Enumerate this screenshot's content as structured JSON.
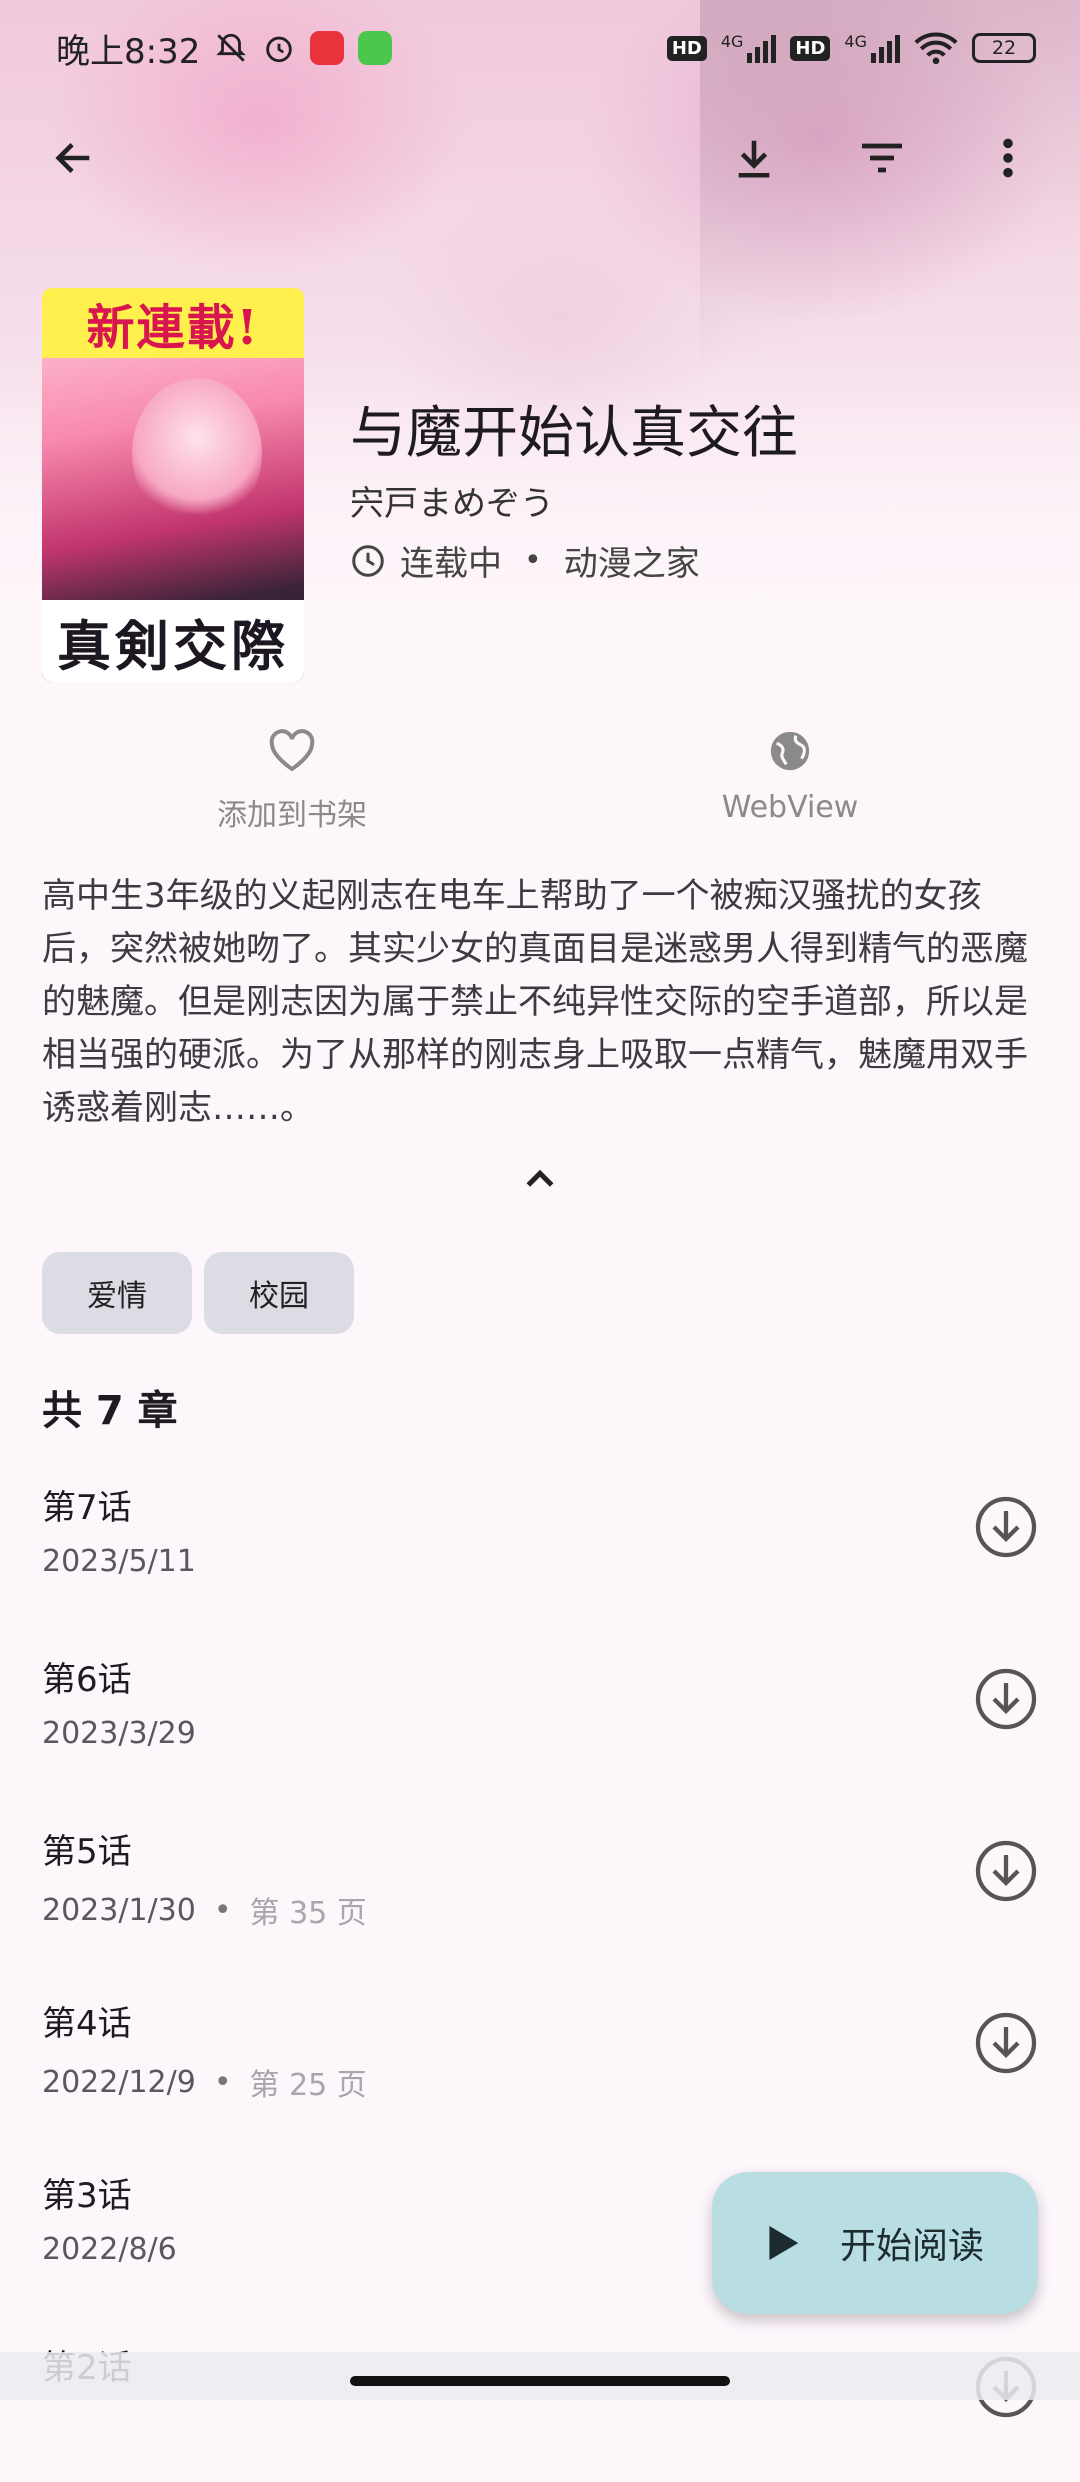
{
  "status_bar": {
    "time": "晚上8:32",
    "network_1": "4G",
    "network_2": "4G",
    "hd_1": "HD",
    "hd_2": "HD",
    "battery": "22"
  },
  "toolbar": {
    "back_icon": "arrow-left-icon",
    "download_icon": "download-icon",
    "filter_icon": "filter-icon",
    "more_icon": "more-vert-icon"
  },
  "manga": {
    "cover_top_text": "新連載!",
    "cover_bottom_text": "真剣交際",
    "title": "与魔开始认真交往",
    "author": "宍戸まめぞう",
    "status": "连载中",
    "source": "动漫之家"
  },
  "actions": {
    "add_to_library": "添加到书架",
    "webview": "WebView"
  },
  "description": "高中生3年级的义起刚志在电车上帮助了一个被痴汉骚扰的女孩后，突然被她吻了。其实少女的真面目是迷惑男人得到精气的恶魔的魅魔。但是刚志因为属于禁止不纯异性交际的空手道部，所以是相当强的硬派。为了从那样的刚志身上吸取一点精气，魅魔用双手诱惑着刚志……。",
  "tags": [
    "爱情",
    "校园"
  ],
  "chapter_count": "共 7 章",
  "chapters": [
    {
      "title": "第7话",
      "date": "2023/5/11",
      "pages": ""
    },
    {
      "title": "第6话",
      "date": "2023/3/29",
      "pages": ""
    },
    {
      "title": "第5话",
      "date": "2023/1/30",
      "pages": "第 35 页"
    },
    {
      "title": "第4话",
      "date": "2022/12/9",
      "pages": "第 25 页"
    },
    {
      "title": "第3话",
      "date": "2022/8/6",
      "pages": ""
    },
    {
      "title": "第2话",
      "date": "",
      "pages": ""
    }
  ],
  "fab": {
    "label": "开始阅读"
  }
}
